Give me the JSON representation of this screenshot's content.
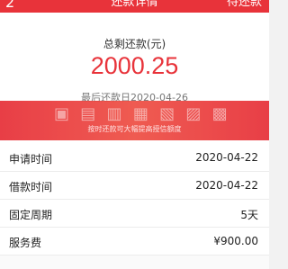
{
  "header": {
    "back_label": "2",
    "title": "还款详情",
    "right_label": "待还款",
    "color": "#e8333a"
  },
  "summary": {
    "label": "总剩还款(元)",
    "amount": "2000.25",
    "last_date": "最后还款日2020-04-26"
  },
  "banner": {
    "subtitle": "按时还款可大幅提高授信额度"
  },
  "details": [
    {
      "key": "申请时间",
      "value": "2020-04-22"
    },
    {
      "key": "借款时间",
      "value": "2020-04-22"
    },
    {
      "key": "固定周期",
      "value": "5天"
    },
    {
      "key": "服务费",
      "value": "¥900.00"
    }
  ]
}
